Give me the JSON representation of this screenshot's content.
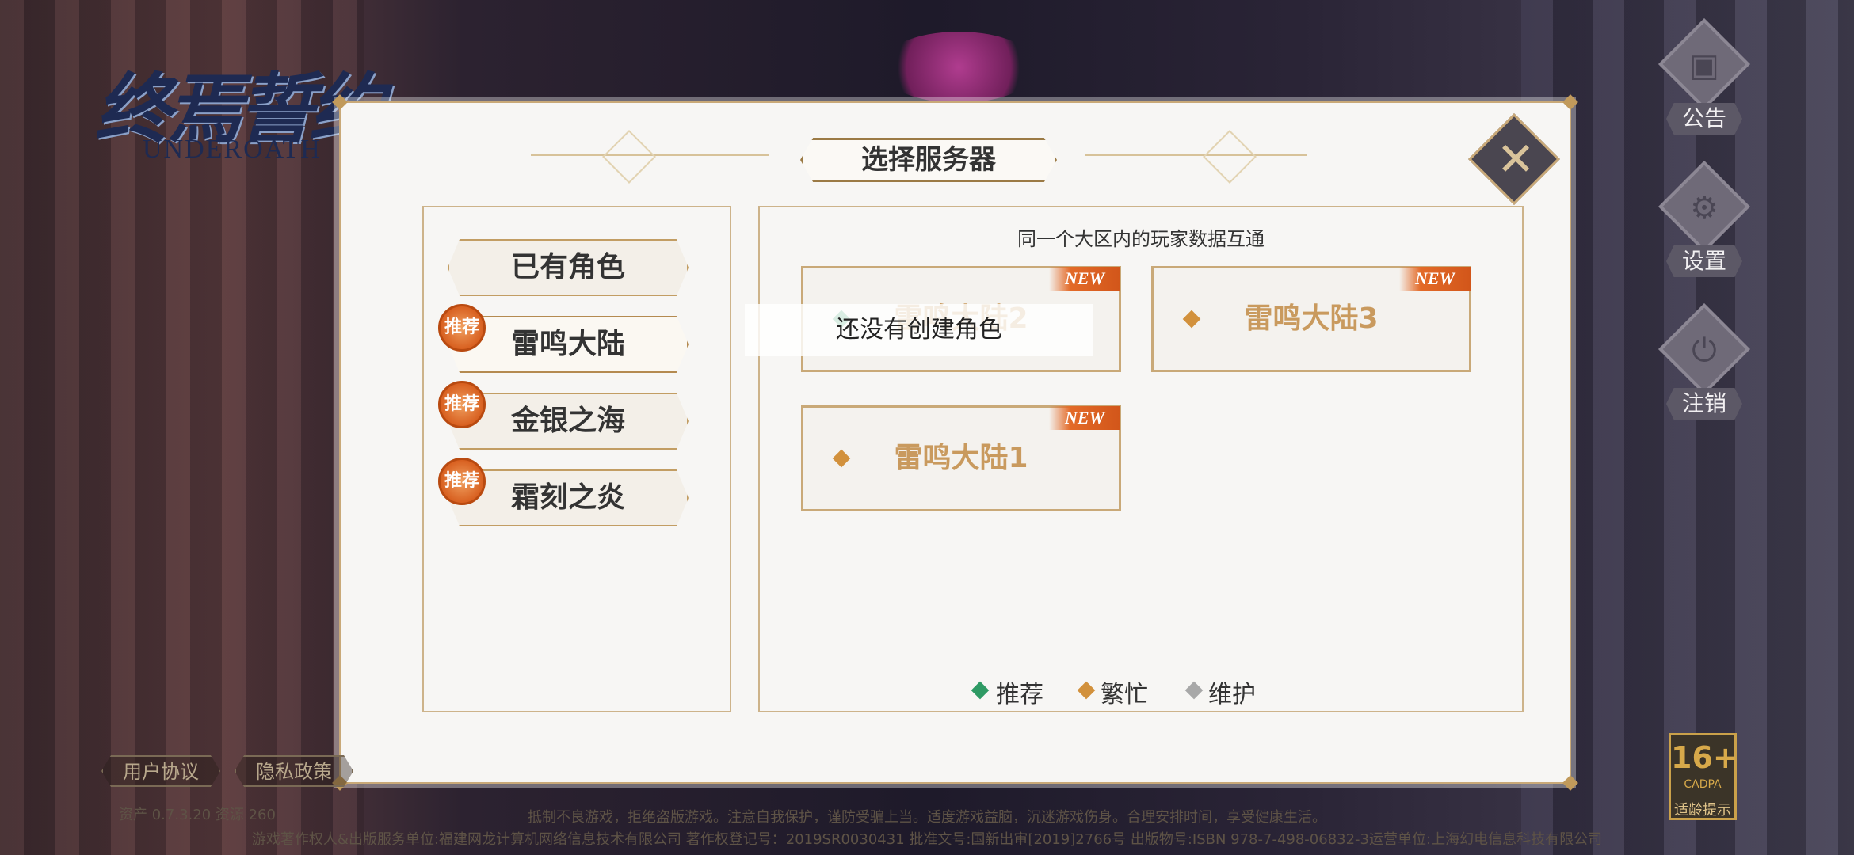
{
  "logo": {
    "cn": "终焉誓约",
    "en": "UNDEROATH"
  },
  "side_menu": [
    {
      "label": "公告",
      "icon": "notice-board-icon",
      "glyph": "▣"
    },
    {
      "label": "设置",
      "icon": "gear-icon",
      "glyph": "⚙"
    },
    {
      "label": "注销",
      "icon": "power-icon",
      "glyph": "⏻"
    }
  ],
  "dialog": {
    "title": "选择服务器",
    "close_glyph": "✕",
    "regions": [
      {
        "label": "已有角色",
        "recommended": false
      },
      {
        "label": "雷鸣大陆",
        "recommended": true
      },
      {
        "label": "金银之海",
        "recommended": true
      },
      {
        "label": "霜刻之炎",
        "recommended": true
      }
    ],
    "recommend_badge": "推荐",
    "notice": "同一个大区内的玩家数据互通",
    "servers": [
      {
        "name": "雷鸣大陆2",
        "tag": "NEW",
        "status": "recommended"
      },
      {
        "name": "雷鸣大陆3",
        "tag": "NEW",
        "status": "busy"
      },
      {
        "name": "雷鸣大陆1",
        "tag": "NEW",
        "status": "busy"
      }
    ],
    "legend": [
      {
        "label": "推荐",
        "color": "#2e9a64"
      },
      {
        "label": "繁忙",
        "color": "#d2913c"
      },
      {
        "label": "维护",
        "color": "#a8a8a8"
      }
    ],
    "status_colors": {
      "recommended": "#2e9a64",
      "busy": "#d2913c",
      "maintenance": "#a8a8a8"
    }
  },
  "tooltip": "还没有创建角色",
  "footer": {
    "user_agreement": "用户协议",
    "privacy_policy": "隐私政策",
    "version": "资产 0.7.3.20  资源 260",
    "health_notice": "抵制不良游戏，拒绝盗版游戏。注意自我保护，谨防受骗上当。适度游戏益脑，沉迷游戏伤身。合理安排时间，享受健康生活。",
    "copyright": "游戏著作权人&出版服务单位:福建网龙计算机网络信息技术有限公司  著作权登记号：2019SR0030431  批准文号:国新出审[2019]2766号  出版物号:ISBN 978-7-498-06832-3运营单位:上海幻电信息科技有限公司",
    "age": {
      "rating": "16+",
      "sub": "CADPA",
      "label": "适龄提示"
    }
  }
}
